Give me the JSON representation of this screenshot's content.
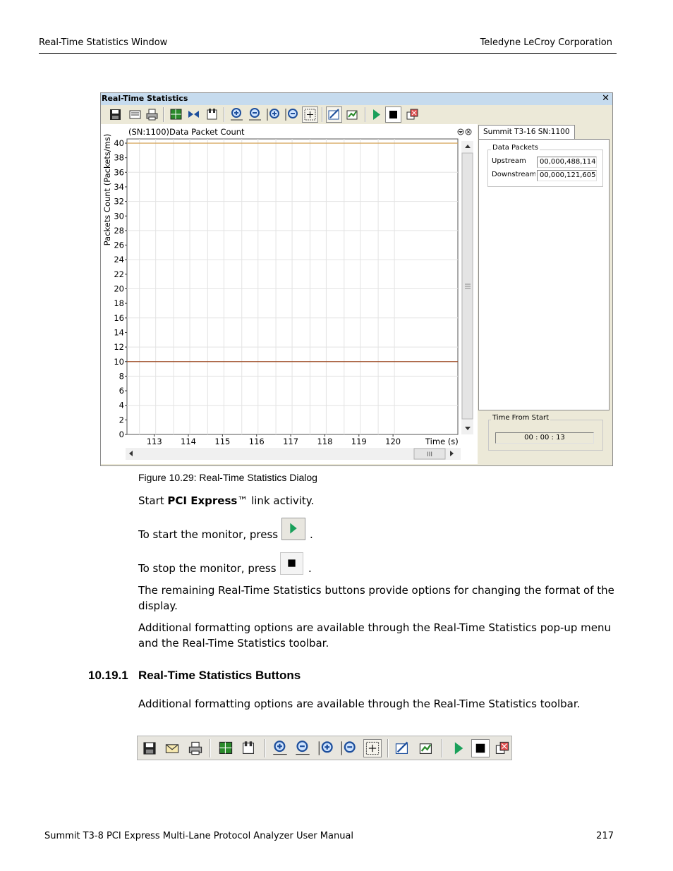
{
  "header": {
    "left": "Real-Time Statistics Window",
    "right": "Teledyne LeCroy Corporation"
  },
  "dialog": {
    "title": "Real-Time Statistics",
    "close_glyph": "✕",
    "toolbar_icons": [
      "save-icon",
      "print-preview-icon",
      "print-icon",
      "chart-view-icon",
      "split-icon",
      "properties-icon",
      "zoom-in-x-icon",
      "zoom-out-x-icon",
      "zoom-in-y-icon",
      "zoom-out-y-icon",
      "crosshair-icon",
      "fit-icon",
      "restore-icon",
      "start-icon",
      "stop-icon",
      "close-monitor-icon"
    ],
    "tab": "Summit T3-16 SN:1100",
    "data_packets": {
      "legend": "Data Packets",
      "upstream_label": "Upstream",
      "upstream_value": "00,000,488,114",
      "downstream_label": "Downstream",
      "downstream_value": "00,000,121,605"
    },
    "time_from_start": {
      "legend": "Time From Start",
      "value": "00 : 00 : 13"
    },
    "scroll_thumb": "III"
  },
  "chart_data": {
    "type": "line",
    "title": "(SN:1100)Data Packet Count",
    "xlabel": "Time (s)",
    "ylabel": "Packets Count (Packets/ms)",
    "x_ticks": [
      "113",
      "114",
      "115",
      "116",
      "117",
      "118",
      "119",
      "120"
    ],
    "y_ticks": [
      "0",
      "2",
      "4",
      "6",
      "8",
      "10",
      "12",
      "14",
      "16",
      "18",
      "20",
      "22",
      "24",
      "26",
      "28",
      "30",
      "32",
      "34",
      "36",
      "38",
      "40"
    ],
    "xlim": [
      112.2,
      121.9
    ],
    "ylim": [
      0,
      40
    ],
    "grid": true,
    "series": [
      {
        "color": "#d4a050",
        "x": [
          112.2,
          121.9
        ],
        "y": [
          40,
          40
        ]
      },
      {
        "color": "#a0522d",
        "x": [
          112.2,
          121.9
        ],
        "y": [
          10,
          10
        ]
      }
    ]
  },
  "caption": "Figure 10.29:  Real-Time Statistics Dialog",
  "para1_pre": "Start ",
  "para1_bold": "PCI Express",
  "para1_post": "™ link activity.",
  "start_text": "To start the monitor, press",
  "stop_text": "To stop the monitor, press",
  "period": ".",
  "para_remaining": "The remaining Real-Time Statistics buttons provide options for changing the format of the display.",
  "para_additional": "Additional formatting options are available through the Real-Time Statistics pop-up menu and the Real-Time Statistics toolbar.",
  "section_number": "10.19.1",
  "section_title": "Real-Time Statistics Buttons",
  "para_toolbar": "Additional formatting options are available through the Real-Time Statistics toolbar.",
  "footer": {
    "left": "Summit T3-8 PCI Express Multi-Lane Protocol Analyzer User Manual",
    "right": "217"
  }
}
